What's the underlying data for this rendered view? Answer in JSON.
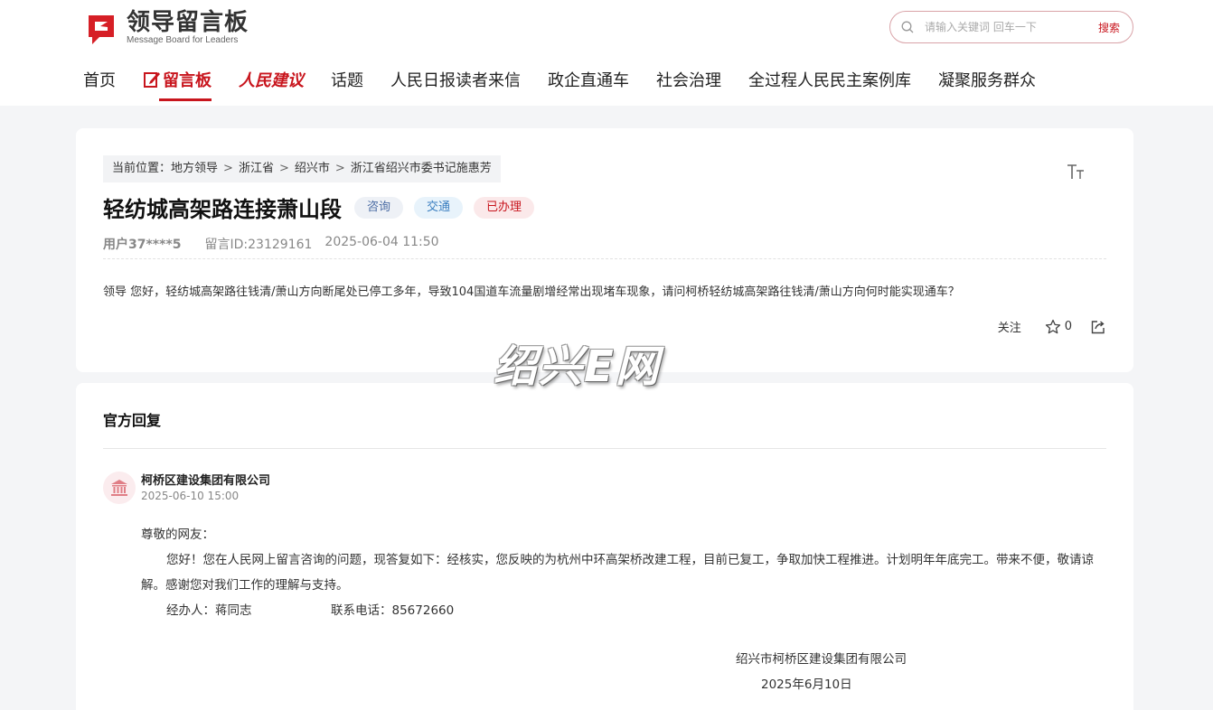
{
  "header": {
    "logo_title": "领导留言板",
    "logo_subtitle": "Message Board for Leaders",
    "search_placeholder": "请输入关键词 回车一下",
    "search_button": "搜索",
    "brand_color": "#c8151d"
  },
  "nav": {
    "items": [
      {
        "label": "首页"
      },
      {
        "label": "留言板",
        "active": true
      },
      {
        "label": "人民建议"
      },
      {
        "label": "话题"
      },
      {
        "label": "人民日报读者来信"
      },
      {
        "label": "政企直通车"
      },
      {
        "label": "社会治理"
      },
      {
        "label": "全过程人民民主案例库"
      },
      {
        "label": "凝聚服务群众"
      }
    ]
  },
  "message": {
    "breadcrumb": {
      "prefix": "当前位置：",
      "items": [
        "地方领导",
        "浙江省",
        "绍兴市",
        "浙江省绍兴市委书记施惠芳"
      ]
    },
    "title": "轻纺城高架路连接萧山段",
    "tags": [
      "咨询",
      "交通",
      "已办理"
    ],
    "user": "用户37****5",
    "message_id": "留言ID:23129161",
    "datetime": "2025-06-04 11:50",
    "content": "领导 您好，轻纺城高架路往钱清/萧山方向断尾处已停工多年，导致104国道车流量剧增经常出现堵车现象，请问柯桥轻纺城高架路往钱清/萧山方向何时能实现通车？",
    "follow_label": "关注",
    "star_count": "0"
  },
  "watermark": "绍兴E网",
  "reply": {
    "heading": "官方回复",
    "org_name": "柯桥区建设集团有限公司",
    "org_time": "2025-06-10 15:00",
    "greeting": "尊敬的网友：",
    "body": "您好！您在人民网上留言咨询的问题，现答复如下：经核实，您反映的为杭州中环高架桥改建工程，目前已复工，争取加快工程推进。计划明年年底完工。带来不便，敬请谅解。感谢您对我们工作的理解与支持。",
    "handler": "经办人：蒋同志",
    "phone": "联系电话：85672660",
    "sign_org": "绍兴市柯桥区建设集团有限公司",
    "sign_date": "2025年6月10日"
  }
}
